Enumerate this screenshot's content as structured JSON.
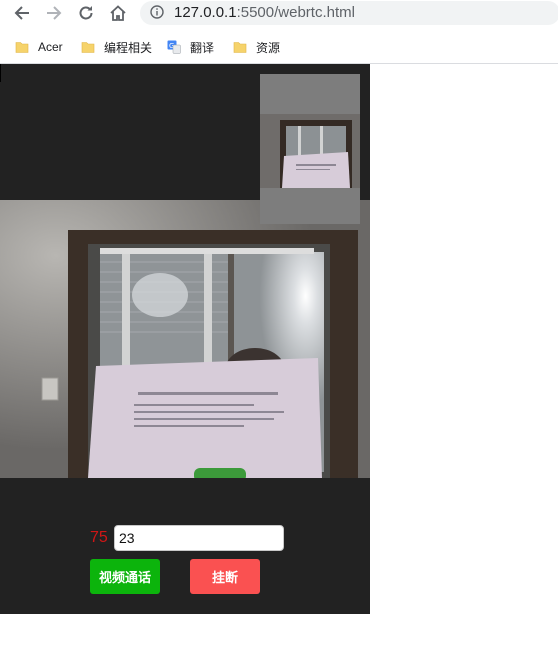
{
  "browser": {
    "url_host": "127.0.0.1",
    "url_path": ":5500/webrtc.html",
    "bookmarks": [
      {
        "label": "Acer",
        "icon": "folder-icon"
      },
      {
        "label": "编程相关",
        "icon": "folder-icon"
      },
      {
        "label": "翻译",
        "icon": "translate-icon"
      },
      {
        "label": "资源",
        "icon": "folder-icon"
      }
    ]
  },
  "page": {
    "counter": "75",
    "input_value": "23",
    "call_button": "视频通话",
    "hangup_button": "挂断"
  },
  "colors": {
    "stage_bg": "#222222",
    "counter": "#d01616",
    "call_button": "#0cb40c",
    "hangup_button": "#fa5151"
  }
}
